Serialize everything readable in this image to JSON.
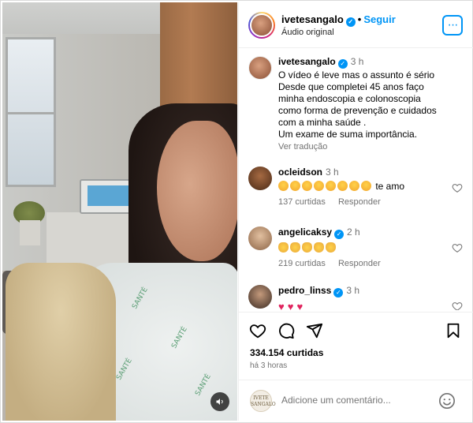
{
  "header": {
    "username": "ivetesangalo",
    "separator": "•",
    "follow_label": "Seguir",
    "subtitle": "Áudio original",
    "more_label": "···"
  },
  "caption": {
    "username": "ivetesangalo",
    "time": "3 h",
    "lines": [
      "O vídeo é leve mas o assunto é sério",
      "Desde que completei 45 anos faço",
      "minha endoscopia e colonoscopia",
      "como forma de prevenção e cuidados",
      "com a minha saúde .",
      "Um exame de suma importância."
    ],
    "translate_label": "Ver tradução"
  },
  "comments": [
    {
      "username": "ocleidson",
      "time": "3 h",
      "emoji": "laugh",
      "emoji_count": 8,
      "text": "te amo",
      "likes": "137 curtidas",
      "reply": "Responder",
      "verified": true
    },
    {
      "username": "angelicaksy",
      "time": "2 h",
      "emoji": "clap",
      "emoji_count": 5,
      "text": "",
      "likes": "219 curtidas",
      "reply": "Responder",
      "verified": true
    },
    {
      "username": "pedro_linss",
      "time": "3 h",
      "emoji": "heart",
      "emoji_count": 3,
      "text": "",
      "likes": "",
      "reply": "",
      "verified": true
    }
  ],
  "post": {
    "likes": "334.154 curtidas",
    "time_ago": "há 3 horas"
  },
  "add_comment": {
    "placeholder": "Adicione um comentário...",
    "avatar_text": "IVETE SANGALO"
  },
  "icons": [
    "like-icon",
    "comment-icon",
    "share-icon",
    "save-icon",
    "emoji-icon",
    "audio-icon",
    "verified-icon"
  ],
  "colors": {
    "accent": "#0095f6",
    "heart": "#e0245e",
    "muted": "#737373"
  }
}
